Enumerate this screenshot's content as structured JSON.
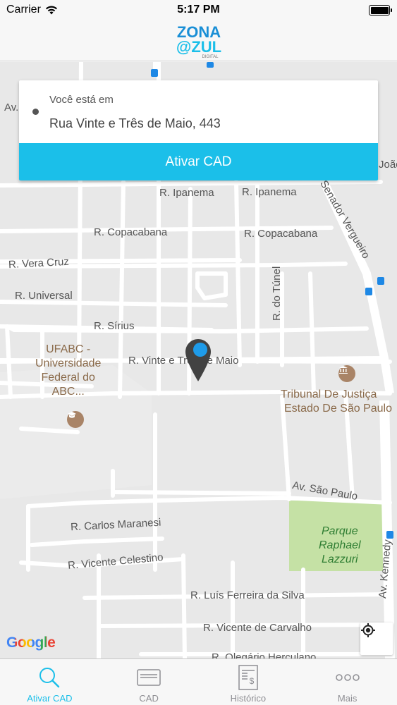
{
  "status_bar": {
    "carrier": "Carrier",
    "time": "5:17 PM"
  },
  "header": {
    "logo_line1": "ZONA",
    "logo_line2": "@ZUL",
    "logo_small": "DIGITAL"
  },
  "location_card": {
    "caption": "Você está em",
    "address": "Rua Vinte e Três de Maio, 443",
    "button_label": "Ativar CAD"
  },
  "map": {
    "streets": {
      "av_top_left": "Av.",
      "joao": "João",
      "ipanema_1": "R. Ipanema",
      "ipanema_2": "R. Ipanema",
      "copacabana_1": "R. Copacabana",
      "copacabana_2": "R. Copacabana",
      "vera_cruz": "R. Vera Cruz",
      "universal": "R. Universal",
      "sirius": "R. Sírius",
      "vinte_tres_maio": "R. Vinte e Três de Maio",
      "do_tunel": "R. do Túnel",
      "senador_vergueiro": "Senador Vergueiro",
      "av_sao_paulo": "Av. São Paulo",
      "carlos_maranesi": "R. Carlos Maranesi",
      "vicente_celestino": "R. Vicente Celestino",
      "luis_ferreira": "R. Luís Ferreira da Silva",
      "vicente_carvalho": "R. Vicente de Carvalho",
      "olegario": "R. Olegário Herculano",
      "av_kennedy": "Av. Kennedy"
    },
    "poi_ufabc": [
      "UFABC -",
      "Universidade",
      "Federal do",
      "ABC..."
    ],
    "poi_tribunal": [
      "Tribunal De Justiça",
      "Estado De São Paulo"
    ],
    "park": [
      "Parque",
      "Raphael",
      "Lazzuri"
    ],
    "attribution": "Google"
  },
  "tabs": [
    {
      "label": "Ativar CAD",
      "icon": "search-icon",
      "active": true
    },
    {
      "label": "CAD",
      "icon": "card-icon",
      "active": false
    },
    {
      "label": "Histórico",
      "icon": "receipt-icon",
      "active": false
    },
    {
      "label": "Mais",
      "icon": "more-icon",
      "active": false
    }
  ],
  "colors": {
    "accent": "#1bbfe9",
    "pin": "#424242",
    "pin_dot": "#1e9be9",
    "park": "#c5e1a5",
    "map_bg": "#e8e8e8",
    "road": "#ffffff"
  }
}
